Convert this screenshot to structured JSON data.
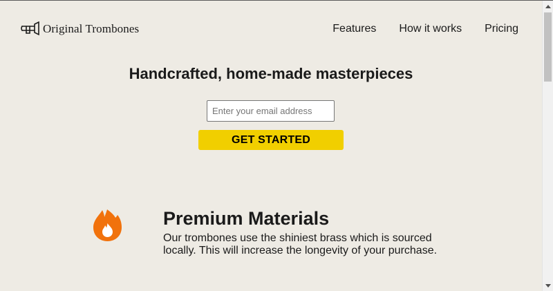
{
  "brand": {
    "logo_icon": "trombone-logo-icon",
    "name": "Original Trombones"
  },
  "nav": {
    "items": [
      {
        "label": "Features"
      },
      {
        "label": "How it works"
      },
      {
        "label": "Pricing"
      }
    ]
  },
  "hero": {
    "title": "Handcrafted, home-made masterpieces",
    "email_placeholder": "Enter your email address",
    "email_value": "",
    "cta_label": "GET STARTED"
  },
  "feature": {
    "icon": "fire-icon",
    "title": "Premium Materials",
    "description": "Our trombones use the shiniest brass which is sourced locally. This will increase the longevity of your purchase."
  },
  "colors": {
    "background": "#eeebe4",
    "cta": "#f1cf00",
    "icon_accent": "#f1720c",
    "text": "#1a1a1a"
  }
}
